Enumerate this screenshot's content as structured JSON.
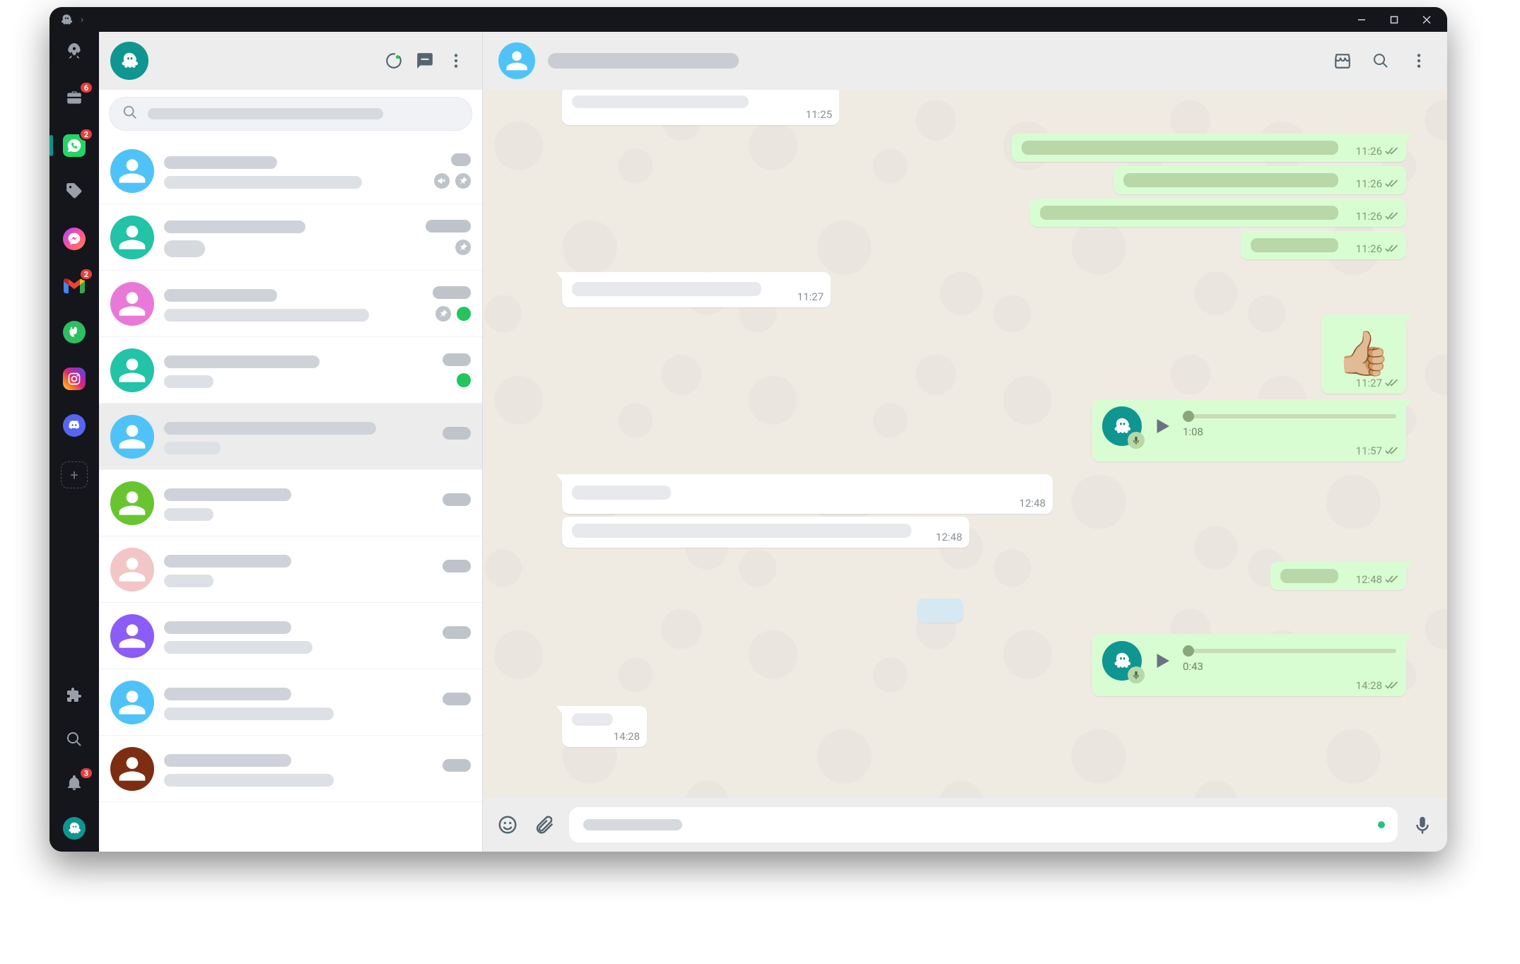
{
  "window": {
    "title": ""
  },
  "rail": {
    "items": [
      {
        "name": "rocket",
        "icon": "rocket",
        "badge": null,
        "bg": "transparent"
      },
      {
        "name": "work",
        "icon": "briefcase",
        "badge": "6",
        "bg": "transparent"
      },
      {
        "name": "whatsapp",
        "icon": "whatsapp",
        "badge": "2",
        "bg": "#25d366",
        "active": true
      },
      {
        "name": "tags",
        "icon": "tag",
        "badge": null,
        "bg": "transparent"
      },
      {
        "name": "messenger",
        "icon": "messenger",
        "badge": null,
        "bg": "linear-gradient(135deg,#a446ff,#ff4fa0,#ff8a3d)"
      },
      {
        "name": "gmail",
        "icon": "gmail",
        "badge": "2",
        "bg": "transparent"
      },
      {
        "name": "evernote",
        "icon": "evernote",
        "badge": null,
        "bg": "#2dbe60"
      },
      {
        "name": "instagram",
        "icon": "instagram",
        "badge": null,
        "bg": "linear-gradient(45deg,#feda75,#fa7e1e,#d62976,#962fbf,#4f5bd5)"
      },
      {
        "name": "discord",
        "icon": "discord",
        "badge": null,
        "bg": "#5865f2"
      }
    ],
    "bottom_badges": {
      "bell": "3"
    }
  },
  "wa": {
    "header_icons": [
      "status",
      "new-chat",
      "menu"
    ],
    "chats": [
      {
        "avatar": "#4fc3f7",
        "top_w": 160,
        "bot_w": 280,
        "time_w": 28,
        "icons": [
          "mute",
          "pin"
        ]
      },
      {
        "avatar": "#22c3a6",
        "top_w": 200,
        "bot_w": 58,
        "time_w": 64,
        "icons": [
          "pin"
        ],
        "bot_pill": true
      },
      {
        "avatar": "#e879d8",
        "top_w": 160,
        "bot_w": 290,
        "time_w": 54,
        "icons": [
          "pin"
        ],
        "online": true
      },
      {
        "avatar": "#22c3a6",
        "top_w": 220,
        "bot_w": 70,
        "time_w": 40,
        "online": true
      },
      {
        "avatar": "#4fc3f7",
        "top_w": 300,
        "bot_w": 80,
        "time_w": 40,
        "selected": true
      },
      {
        "avatar": "#69c52f",
        "top_w": 180,
        "bot_w": 70,
        "time_w": 40
      },
      {
        "avatar": "#f2c6c6",
        "top_w": 180,
        "bot_w": 70,
        "time_w": 40
      },
      {
        "avatar": "#8b5cf6",
        "top_w": 180,
        "bot_w": 210,
        "time_w": 40
      },
      {
        "avatar": "#4fc3f7",
        "top_w": 180,
        "bot_w": 240,
        "time_w": 40
      },
      {
        "avatar": "#7c2d12",
        "top_w": 180,
        "bot_w": 240,
        "time_w": 40
      }
    ]
  },
  "conv": {
    "messages": {
      "m_in_1": {
        "time": "11:25"
      },
      "m_out_1": {
        "time": "11:26"
      },
      "m_out_2": {
        "time": "11:26"
      },
      "m_out_3": {
        "time": "11:26"
      },
      "m_out_4": {
        "time": "11:26"
      },
      "m_in_2": {
        "time": "11:27"
      },
      "m_out_thumb": {
        "time": "11:27",
        "emoji": "👍🏼"
      },
      "voice_1": {
        "dur": "1:08",
        "time": "11:57"
      },
      "m_in_3a": {
        "time": "12:48"
      },
      "m_in_3b": {
        "time": "12:48"
      },
      "m_out_5": {
        "time": "12:48"
      },
      "voice_2": {
        "dur": "0:43",
        "time": "14:28"
      },
      "m_in_4": {
        "time": "14:28"
      }
    }
  }
}
